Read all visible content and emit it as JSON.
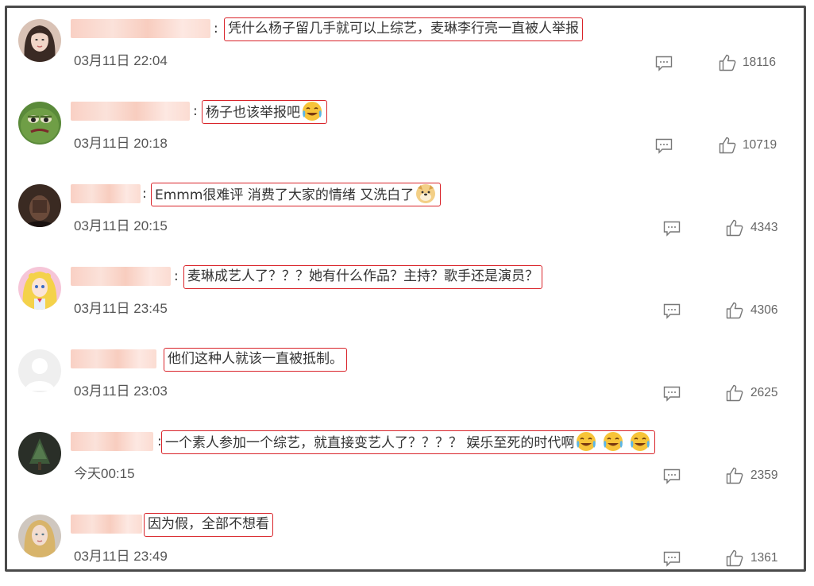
{
  "comments": [
    {
      "text": "凭什么杨子留几手就可以上综艺，麦琳李行亮一直被人举报",
      "time": "03月11日 22:04",
      "likes": "18116",
      "avatar": "woman-long-hair",
      "emoji": []
    },
    {
      "text": "杨子也该举报吧",
      "time": "03月11日 20:18",
      "likes": "10719",
      "avatar": "green-frog",
      "emoji": [
        "crying-laugh"
      ]
    },
    {
      "text": "Emmm很难评 消费了大家的情绪 又洗白了",
      "time": "03月11日 20:15",
      "likes": "4343",
      "avatar": "person-dark",
      "emoji": [
        "doge"
      ]
    },
    {
      "text": "麦琳成艺人了？？？她有什么作品？主持？歌手还是演员？",
      "time": "03月11日 23:45",
      "likes": "4306",
      "avatar": "sailor-moon",
      "emoji": []
    },
    {
      "text": "他们这种人就该一直被抵制。",
      "time": "03月11日 23:03",
      "likes": "2625",
      "avatar": "default-gray",
      "emoji": []
    },
    {
      "text": "一个素人参加一个综艺，就直接变艺人了？？？？ 娱乐至死的时代啊",
      "time": "今天00:15",
      "likes": "2359",
      "avatar": "tree-dark",
      "emoji": [
        "crying-laugh",
        "crying-laugh",
        "crying-laugh"
      ]
    },
    {
      "text": "因为假，全部不想看",
      "time": "03月11日 23:49",
      "likes": "1361",
      "avatar": "doll-blonde",
      "emoji": []
    }
  ],
  "colors": {
    "highlight_border": "#d9242a",
    "frame": "#4a4a4a",
    "username_blur": "#f9d0c4"
  }
}
